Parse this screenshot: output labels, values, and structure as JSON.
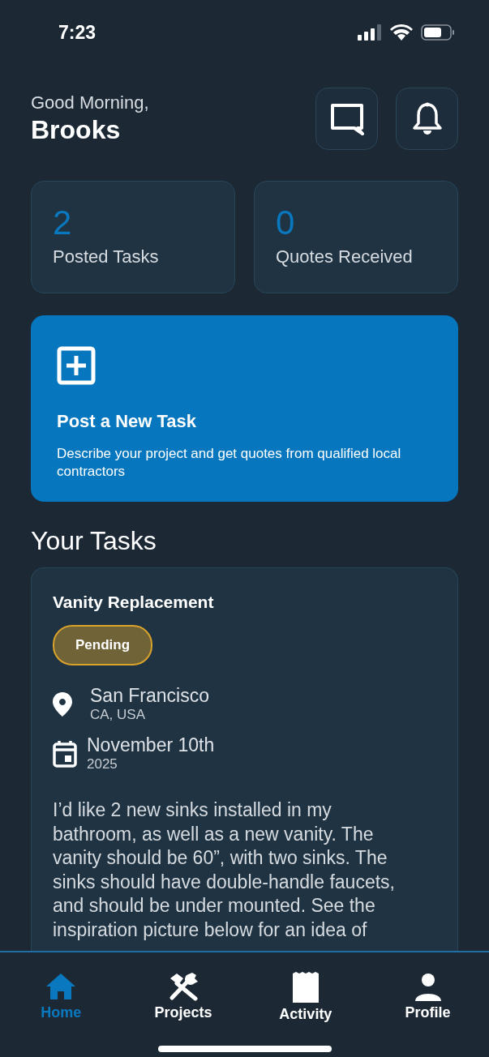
{
  "status_bar": {
    "time": "7:23"
  },
  "header": {
    "greeting": "Good Morning,",
    "name": "Brooks"
  },
  "stats": [
    {
      "value": "2",
      "label": "Posted Tasks"
    },
    {
      "value": "0",
      "label": "Quotes Received"
    }
  ],
  "post_task": {
    "title": "Post a New Task",
    "description": "Describe your project and get quotes from qualified local contractors"
  },
  "section_title": "Your Tasks",
  "tasks": [
    {
      "title": "Vanity Replacement",
      "status": {
        "label": "Pending",
        "color": "#d9a22a"
      },
      "city": "San Francisco",
      "region": "CA, USA",
      "date": "November 10th",
      "year": "2025",
      "description": "I’d like 2 new sinks installed in my bathroom, as well as a new vanity. The vanity should be 60”, with two sinks. The sinks should have double-handle faucets, and should be under mounted. See the inspiration picture below for an idea of"
    }
  ],
  "tab_bar": [
    {
      "kind": "home",
      "label": "Home",
      "selected": true
    },
    {
      "kind": "projects",
      "label": "Projects",
      "selected": false
    },
    {
      "kind": "activity",
      "label": "Activity",
      "selected": false
    },
    {
      "kind": "profile",
      "label": "Profile",
      "selected": false
    }
  ]
}
